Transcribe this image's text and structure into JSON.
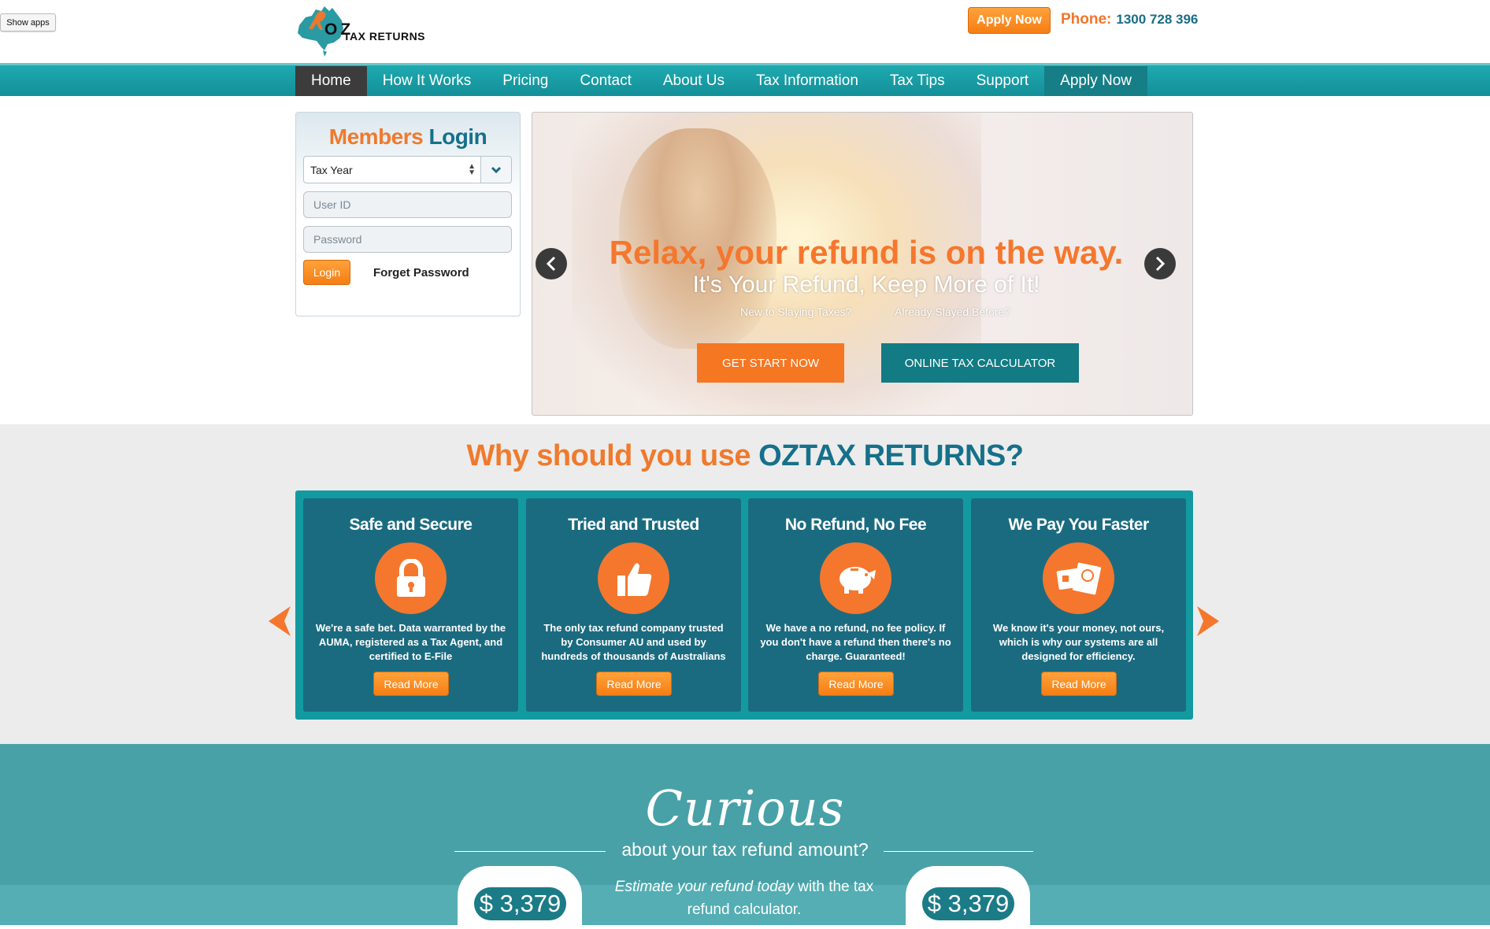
{
  "browser": {
    "show_apps": "Show apps"
  },
  "logo": {
    "oz": "OZ",
    "text": "TAX RETURNS"
  },
  "header": {
    "apply_now": "Apply Now",
    "phone_label": "Phone:",
    "phone_number": "1300 728 396"
  },
  "nav": {
    "items": [
      "Home",
      "How It Works",
      "Pricing",
      "Contact",
      "About Us",
      "Tax Information",
      "Tax Tips",
      "Support",
      "Apply Now"
    ],
    "active": "Home"
  },
  "login": {
    "title_a": "Members",
    "title_b": "Login",
    "tax_year": "Tax Year",
    "user_placeholder": "User ID",
    "password_placeholder": "Password",
    "login_button": "Login",
    "forget": "Forget Password"
  },
  "hero": {
    "title": "Relax, your refund is on the way.",
    "subtitle": "It's Your Refund, Keep More of It!",
    "new_label": "New to Slaying Taxes?",
    "already_label": "Already Slayed Before?",
    "start_button": "GET START NOW",
    "calc_button": "ONLINE TAX CALCULATOR"
  },
  "why": {
    "title_a": "Why should you use",
    "title_b": "OZTAX RETURNS?",
    "cards": [
      {
        "title": "Safe and Secure",
        "icon": "lock-icon",
        "text": "We're a safe bet. Data warranted by the AUMA, registered as a Tax Agent, and certified to E-File",
        "button": "Read More"
      },
      {
        "title": "Tried and Trusted",
        "icon": "thumbs-up-icon",
        "text": "The only tax refund company trusted by Consumer AU and used by hundreds of thousands of Australians",
        "button": "Read More"
      },
      {
        "title": "No Refund, No Fee",
        "icon": "piggy-bank-icon",
        "text": "We have a no refund, no fee policy. If you don't have a refund then there's no charge. Guaranteed!",
        "button": "Read More"
      },
      {
        "title": "We Pay You Faster",
        "icon": "passport-icon",
        "text": "We know it's your money, not ours, which is why our systems are all designed for efficiency.",
        "button": "Read More"
      }
    ]
  },
  "curious": {
    "script": "Curious",
    "about": "about your tax refund amount?",
    "estimate_em": "Estimate your refund today",
    "estimate_rest": " with the tax refund calculator.",
    "amount_left": "$ 3,379",
    "amount_right": "$ 3,379"
  },
  "colors": {
    "orange": "#f5772d",
    "teal": "#16708a",
    "teal_bright": "#139aa0"
  }
}
